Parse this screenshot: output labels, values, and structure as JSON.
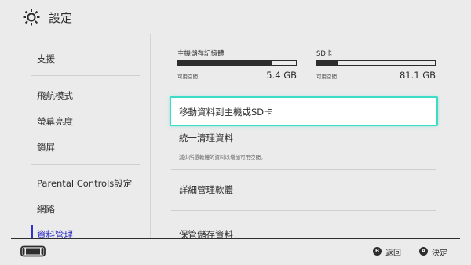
{
  "header": {
    "title": "設定",
    "icon": "gear-icon"
  },
  "sidebar": {
    "items": [
      {
        "label": "支援"
      },
      {
        "label": "飛航模式"
      },
      {
        "label": "螢幕亮度"
      },
      {
        "label": "鎖屏"
      },
      {
        "label": "Parental Controls設定"
      },
      {
        "label": "網路"
      },
      {
        "label": "資料管理",
        "selected": true
      }
    ]
  },
  "storage": {
    "internal": {
      "label": "主機儲存記憶體",
      "sub": "可用空間",
      "value": "5.4 GB",
      "used_fraction": 0.8
    },
    "sd": {
      "label": "SD卡",
      "sub": "可用空間",
      "value": "81.1 GB",
      "used_fraction": 0.17
    }
  },
  "options": {
    "move": "移動資料到主機或SD卡",
    "cleanup": "統一清理資料",
    "cleanup_desc": "減少所選軟體的資料以增加可用空間。",
    "manage_software": "詳細管理軟體",
    "save_data": "保管儲存資料"
  },
  "footer": {
    "back_button": "B",
    "back_label": "返回",
    "ok_button": "A",
    "ok_label": "決定"
  },
  "colors": {
    "accent": "#3cdcc8",
    "selected_text": "#2c2cc4",
    "background": "#ebebeb"
  }
}
